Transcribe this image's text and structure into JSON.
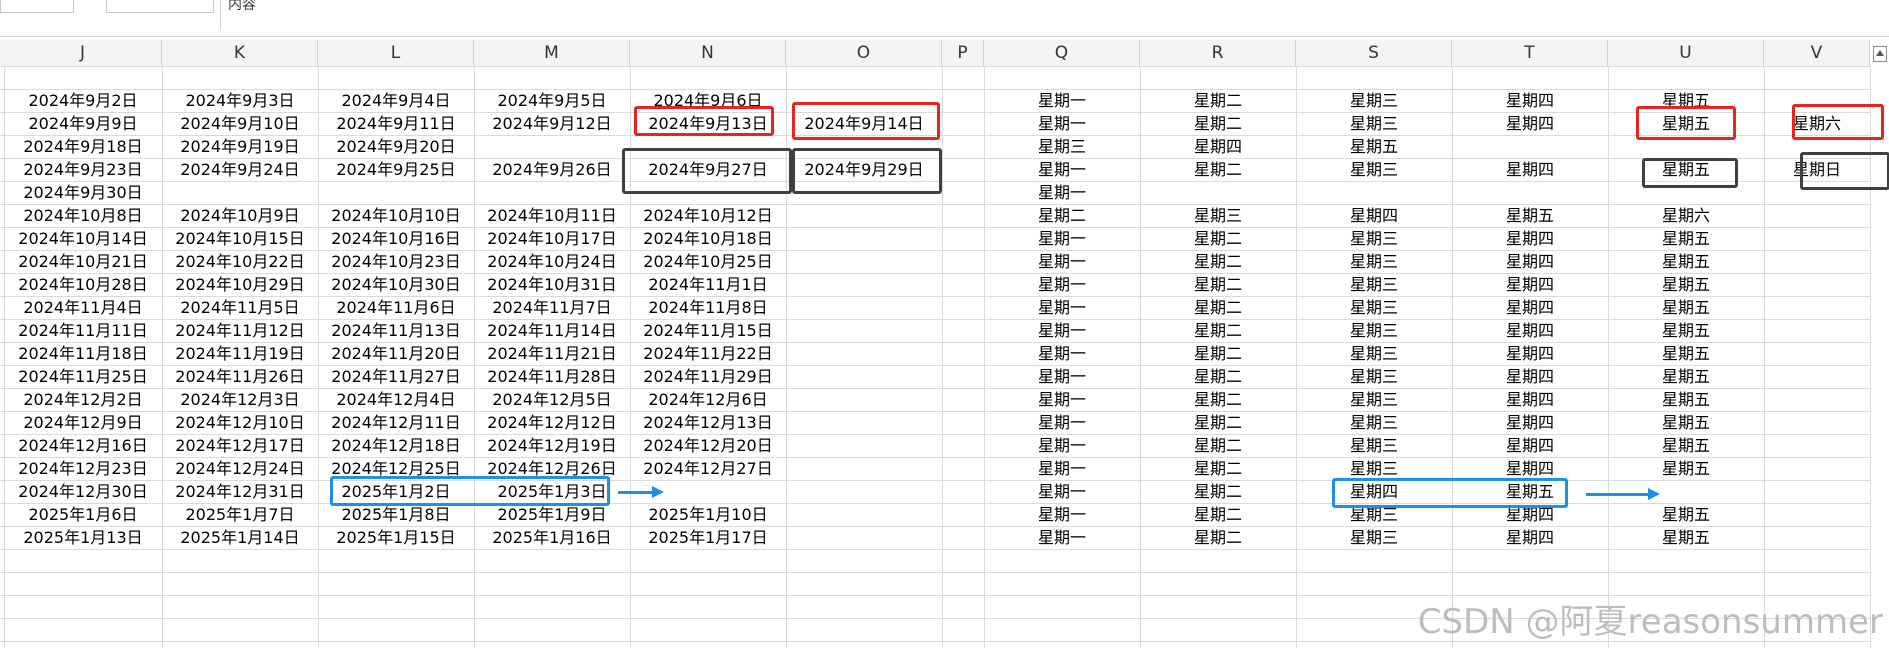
{
  "formula_bar": {
    "content": "内容"
  },
  "columns": [
    "J",
    "K",
    "L",
    "M",
    "N",
    "O",
    "P",
    "Q",
    "R",
    "S",
    "T",
    "U",
    "V"
  ],
  "rows": [
    [
      "",
      "",
      "",
      "",
      "",
      "",
      "",
      "",
      "",
      "",
      "",
      "",
      ""
    ],
    [
      "2024年9月2日",
      "2024年9月3日",
      "2024年9月4日",
      "2024年9月5日",
      "2024年9月6日",
      "",
      "",
      "星期一",
      "星期二",
      "星期三",
      "星期四",
      "星期五",
      ""
    ],
    [
      "2024年9月9日",
      "2024年9月10日",
      "2024年9月11日",
      "2024年9月12日",
      "2024年9月13日",
      "2024年9月14日",
      "",
      "星期一",
      "星期二",
      "星期三",
      "星期四",
      "星期五",
      "星期六"
    ],
    [
      "2024年9月18日",
      "2024年9月19日",
      "2024年9月20日",
      "",
      "",
      "",
      "",
      "星期三",
      "星期四",
      "星期五",
      "",
      "",
      ""
    ],
    [
      "2024年9月23日",
      "2024年9月24日",
      "2024年9月25日",
      "2024年9月26日",
      "2024年9月27日",
      "2024年9月29日",
      "",
      "星期一",
      "星期二",
      "星期三",
      "星期四",
      "星期五",
      "星期日"
    ],
    [
      "2024年9月30日",
      "",
      "",
      "",
      "",
      "",
      "",
      "星期一",
      "",
      "",
      "",
      "",
      ""
    ],
    [
      "2024年10月8日",
      "2024年10月9日",
      "2024年10月10日",
      "2024年10月11日",
      "2024年10月12日",
      "",
      "",
      "星期二",
      "星期三",
      "星期四",
      "星期五",
      "星期六",
      ""
    ],
    [
      "2024年10月14日",
      "2024年10月15日",
      "2024年10月16日",
      "2024年10月17日",
      "2024年10月18日",
      "",
      "",
      "星期一",
      "星期二",
      "星期三",
      "星期四",
      "星期五",
      ""
    ],
    [
      "2024年10月21日",
      "2024年10月22日",
      "2024年10月23日",
      "2024年10月24日",
      "2024年10月25日",
      "",
      "",
      "星期一",
      "星期二",
      "星期三",
      "星期四",
      "星期五",
      ""
    ],
    [
      "2024年10月28日",
      "2024年10月29日",
      "2024年10月30日",
      "2024年10月31日",
      "2024年11月1日",
      "",
      "",
      "星期一",
      "星期二",
      "星期三",
      "星期四",
      "星期五",
      ""
    ],
    [
      "2024年11月4日",
      "2024年11月5日",
      "2024年11月6日",
      "2024年11月7日",
      "2024年11月8日",
      "",
      "",
      "星期一",
      "星期二",
      "星期三",
      "星期四",
      "星期五",
      ""
    ],
    [
      "2024年11月11日",
      "2024年11月12日",
      "2024年11月13日",
      "2024年11月14日",
      "2024年11月15日",
      "",
      "",
      "星期一",
      "星期二",
      "星期三",
      "星期四",
      "星期五",
      ""
    ],
    [
      "2024年11月18日",
      "2024年11月19日",
      "2024年11月20日",
      "2024年11月21日",
      "2024年11月22日",
      "",
      "",
      "星期一",
      "星期二",
      "星期三",
      "星期四",
      "星期五",
      ""
    ],
    [
      "2024年11月25日",
      "2024年11月26日",
      "2024年11月27日",
      "2024年11月28日",
      "2024年11月29日",
      "",
      "",
      "星期一",
      "星期二",
      "星期三",
      "星期四",
      "星期五",
      ""
    ],
    [
      "2024年12月2日",
      "2024年12月3日",
      "2024年12月4日",
      "2024年12月5日",
      "2024年12月6日",
      "",
      "",
      "星期一",
      "星期二",
      "星期三",
      "星期四",
      "星期五",
      ""
    ],
    [
      "2024年12月9日",
      "2024年12月10日",
      "2024年12月11日",
      "2024年12月12日",
      "2024年12月13日",
      "",
      "",
      "星期一",
      "星期二",
      "星期三",
      "星期四",
      "星期五",
      ""
    ],
    [
      "2024年12月16日",
      "2024年12月17日",
      "2024年12月18日",
      "2024年12月19日",
      "2024年12月20日",
      "",
      "",
      "星期一",
      "星期二",
      "星期三",
      "星期四",
      "星期五",
      ""
    ],
    [
      "2024年12月23日",
      "2024年12月24日",
      "2024年12月25日",
      "2024年12月26日",
      "2024年12月27日",
      "",
      "",
      "星期一",
      "星期二",
      "星期三",
      "星期四",
      "星期五",
      ""
    ],
    [
      "2024年12月30日",
      "2024年12月31日",
      "2025年1月2日",
      "2025年1月3日",
      "",
      "",
      "",
      "星期一",
      "星期二",
      "星期四",
      "星期五",
      "",
      ""
    ],
    [
      "2025年1月6日",
      "2025年1月7日",
      "2025年1月8日",
      "2025年1月9日",
      "2025年1月10日",
      "",
      "",
      "星期一",
      "星期二",
      "星期三",
      "星期四",
      "星期五",
      ""
    ],
    [
      "2025年1月13日",
      "2025年1月14日",
      "2025年1月15日",
      "2025年1月16日",
      "2025年1月17日",
      "",
      "",
      "星期一",
      "星期二",
      "星期三",
      "星期四",
      "星期五",
      ""
    ]
  ],
  "annotation_colors": {
    "red": "#e8241e",
    "dark": "#404040",
    "blue": "#1e90e8"
  },
  "watermark": "CSDN @阿夏reasonsummer"
}
